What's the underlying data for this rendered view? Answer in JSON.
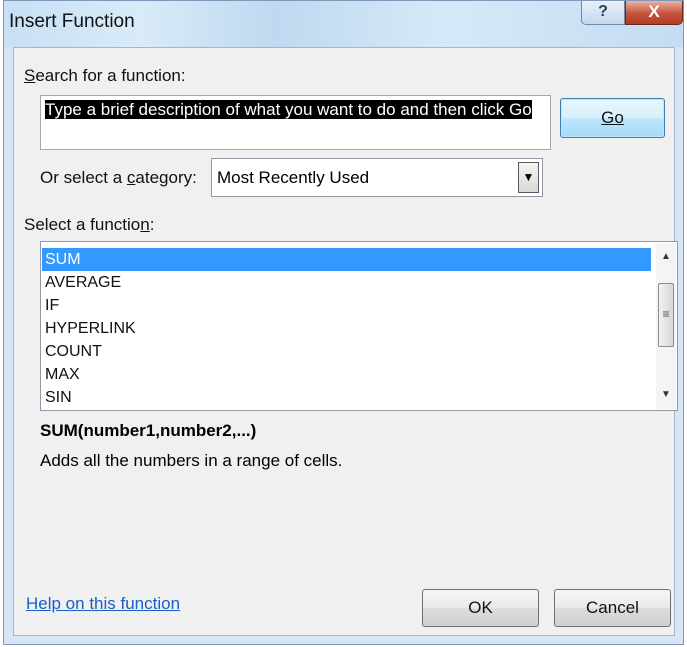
{
  "window": {
    "title": "Insert Function",
    "help_label": "?",
    "close_label": "X"
  },
  "search": {
    "label": "Search for a function:",
    "label_accel_pre": "",
    "label_accel": "S",
    "label_accel_post": "earch for a function:",
    "value": "Type a brief description of what you want to do and then click Go",
    "go_label": "Go"
  },
  "category": {
    "label_pre": "Or select a ",
    "label_accel": "c",
    "label_post": "ategory:",
    "selected": "Most Recently Used"
  },
  "functions": {
    "label_pre": "Select a functio",
    "label_accel": "n",
    "label_post": ":",
    "items": [
      "SUM",
      "AVERAGE",
      "IF",
      "HYPERLINK",
      "COUNT",
      "MAX",
      "SIN"
    ],
    "selected_index": 0
  },
  "details": {
    "signature": "SUM(number1,number2,...)",
    "description": "Adds all the numbers in a range of cells."
  },
  "footer": {
    "help_link": "Help on this function",
    "ok_label": "OK",
    "cancel_label": "Cancel"
  },
  "colors": {
    "selection": "#3399ff",
    "link": "#1a5ec8",
    "close_button": "#c5523b"
  }
}
